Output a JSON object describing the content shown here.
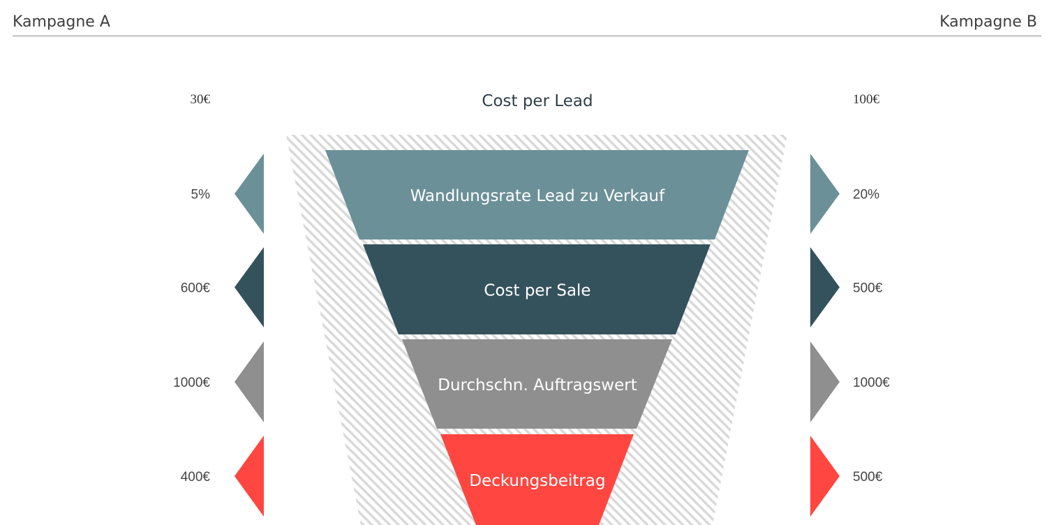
{
  "header": {
    "left": "Kampagne A",
    "right": "Kampagne B"
  },
  "top": {
    "title": "Cost per Lead",
    "left_value": "30€",
    "right_value": "100€"
  },
  "levels": [
    {
      "label": "Wandlungsrate Lead zu Verkauf",
      "a": "5%",
      "b": "20%",
      "color": "#6b9098"
    },
    {
      "label": "Cost per Sale",
      "a": "600€",
      "b": "500€",
      "color": "#34525c"
    },
    {
      "label": "Durchschn. Auftragswert",
      "a": "1000€",
      "b": "1000€",
      "color": "#8f8f8f"
    },
    {
      "label": "Deckungsbeitrag",
      "a": "400€",
      "b": "500€",
      "color": "#ff4640"
    }
  ],
  "colors": {
    "hatch": "#d9d9d9",
    "rule": "#8a8a8a"
  }
}
